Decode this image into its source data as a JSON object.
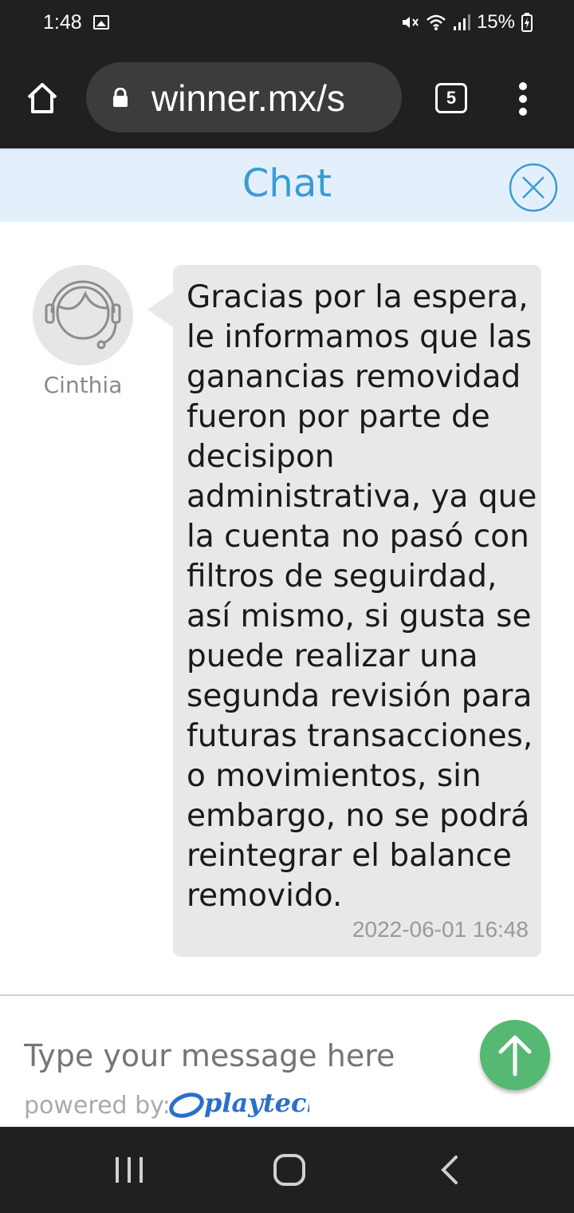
{
  "status_bar": {
    "time": "1:48",
    "battery": "15%",
    "icons": [
      "image-icon",
      "mute-icon",
      "wifi-icon",
      "signal-icon",
      "battery-charging-icon"
    ]
  },
  "browser": {
    "url": "winner.mx/s",
    "tab_count": "5",
    "icons": [
      "home-icon",
      "lock-icon",
      "tabs-icon",
      "more-vert-icon"
    ]
  },
  "chat": {
    "title": "Chat",
    "agent_name": "Cinthia",
    "message_text": "Gracias por la espera, le informamos que las ganancias removidad fueron por parte de decisipon administrativa, ya que la cuenta no pasó con filtros de seguirdad, así mismo, si gusta se puede realizar una segunda revisión para futuras transacciones, o movimientos, sin embargo, no se podrá reintegrar el balance removido.",
    "message_time": "2022-06-01 16:48"
  },
  "composer": {
    "placeholder": "Type your message here",
    "powered_by": "powered by:",
    "brand": "playtech"
  },
  "colors": {
    "accent": "#3a9bd8",
    "header_bg": "#e3f0fb",
    "send_button": "#55b873",
    "bubble_bg": "#e8e8e8",
    "system_bar": "#202020"
  }
}
